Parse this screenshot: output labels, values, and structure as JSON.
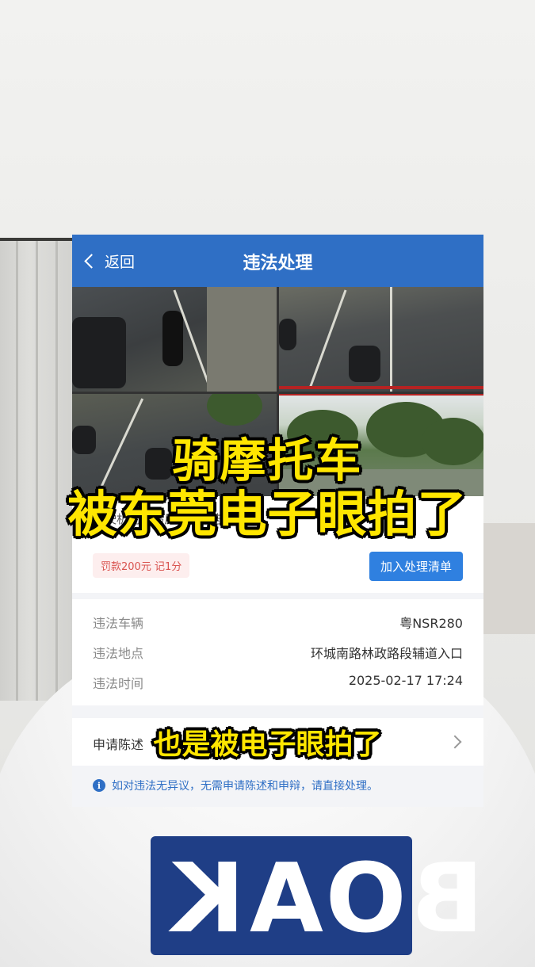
{
  "nav": {
    "back_label": "返回",
    "title": "违法处理"
  },
  "captions": {
    "line1": "骑摩托车",
    "line2": "被东莞电子眼拍了",
    "line3": "也是被电子眼拍了"
  },
  "violation": {
    "description": "驾驶机动车违反禁令标志指示的",
    "fine_badge": "罚款200元 记1分",
    "add_button": "加入处理清单"
  },
  "details": [
    {
      "key": "违法车辆",
      "value": "粤NSR280"
    },
    {
      "key": "违法地点",
      "value": "环城南路林政路段辅道入口"
    },
    {
      "key": "违法时间",
      "value": "2025-02-17 17:24"
    }
  ],
  "appeal": {
    "label": "申请陈述"
  },
  "notice": {
    "text": "如对违法无异议，无需申请陈述和申辩，请直接处理。"
  },
  "shirt": {
    "print_text": "BOAK"
  },
  "colors": {
    "nav_bg": "#2f6fc5",
    "caption": "#ffe600",
    "button": "#2f80e0",
    "fine": "#d9534f"
  }
}
